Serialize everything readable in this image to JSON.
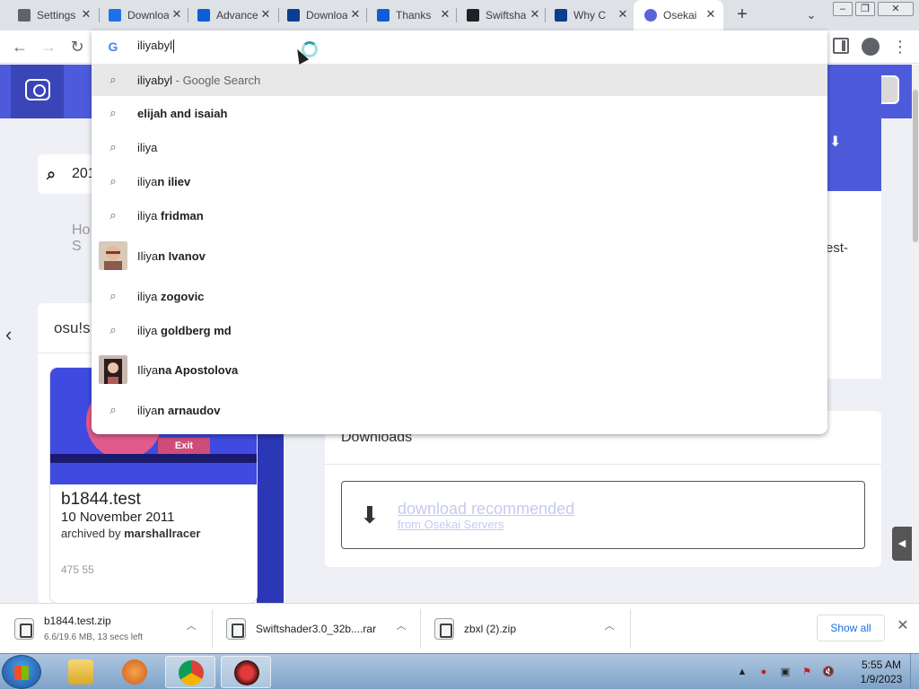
{
  "tabs": [
    {
      "title": "Settings",
      "icon": "settings-icon",
      "color": "#5f6368"
    },
    {
      "title": "Downloads",
      "icon": "download-icon",
      "color": "#1a73e8"
    },
    {
      "title": "Advanced",
      "icon": "edge-icon",
      "color": "#0a5fd6"
    },
    {
      "title": "Download",
      "icon": "edge-icon",
      "color": "#0b3d91"
    },
    {
      "title": "Thanks",
      "icon": "edge-icon",
      "color": "#0a5fd6"
    },
    {
      "title": "Swiftshader",
      "icon": "museum-icon",
      "color": "#202124"
    },
    {
      "title": "Why C",
      "icon": "edge-icon",
      "color": "#0b3d91"
    },
    {
      "title": "Osekai",
      "icon": "osekai-icon",
      "color": "#5a63d8"
    }
  ],
  "omnibox": {
    "value": "iliyabyl",
    "suggestions": [
      {
        "icon": "search-icon",
        "prefix": "iliyabyl",
        "bold": "",
        "sub": " - Google Search",
        "highlighted": true
      },
      {
        "icon": "search-icon",
        "prefix": "",
        "bold": "elijah and isaiah",
        "sub": ""
      },
      {
        "icon": "search-icon",
        "prefix": "iliya",
        "bold": "",
        "sub": ""
      },
      {
        "icon": "search-icon",
        "prefix": "iliya",
        "bold": "n iliev",
        "sub": ""
      },
      {
        "icon": "search-icon",
        "prefix": "iliya ",
        "bold": "fridman",
        "sub": ""
      },
      {
        "icon": "person-avatar",
        "prefix": "Iliya",
        "bold": "n Ivanov",
        "sub": ""
      },
      {
        "icon": "search-icon",
        "prefix": "iliya ",
        "bold": "zogovic",
        "sub": ""
      },
      {
        "icon": "search-icon",
        "prefix": "iliya ",
        "bold": "goldberg md",
        "sub": ""
      },
      {
        "icon": "person-avatar",
        "prefix": "Iliya",
        "bold": "na Apostolova",
        "sub": ""
      },
      {
        "icon": "search-icon",
        "prefix": "iliya",
        "bold": "n arnaudov",
        "sub": ""
      }
    ]
  },
  "page": {
    "search_value": "201",
    "nav_hint": "Ho\nS",
    "left_card_title": "osu!s",
    "right_partial": "est-",
    "beatmap": {
      "thumb_exit": "Exit",
      "title": "b1844.test",
      "date": "10 November 2011",
      "archived_prefix": "archived by ",
      "archived_by": "marshallracer",
      "stats": "475   55"
    },
    "downloads_title": "Downloads",
    "download_line1": "download recommended",
    "download_line2": "from Osekai Servers"
  },
  "shelf": {
    "items": [
      {
        "name": "b1844.test.zip",
        "status": "6.6/19.6 MB, 13 secs left"
      },
      {
        "name": "Swiftshader3.0_32b....rar",
        "status": ""
      },
      {
        "name": "zbxl (2).zip",
        "status": ""
      }
    ],
    "show_all": "Show all"
  },
  "taskbar": {
    "time": "5:55 AM",
    "date": "1/9/2023"
  }
}
